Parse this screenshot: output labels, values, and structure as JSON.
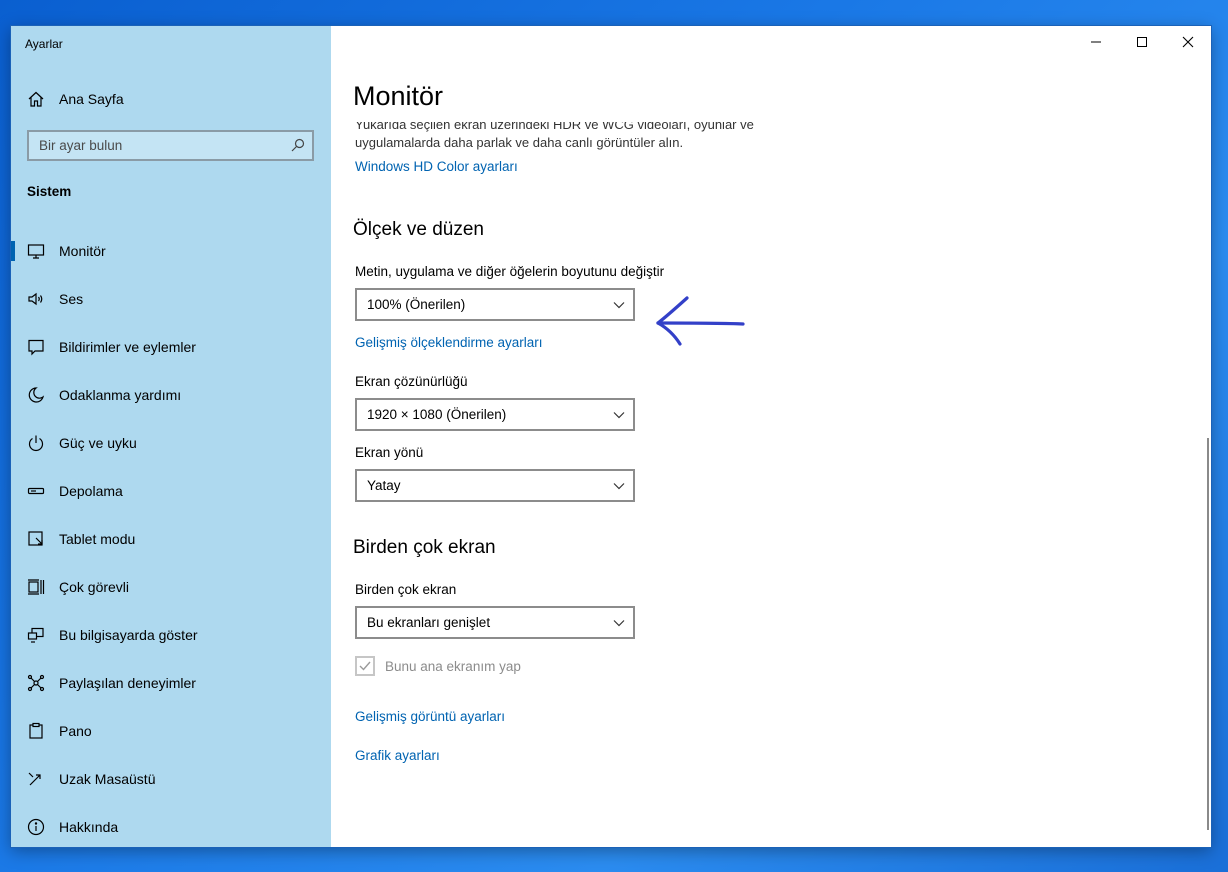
{
  "window": {
    "app_title": "Ayarlar",
    "controls": [
      "minimize",
      "maximize",
      "close"
    ]
  },
  "sidebar": {
    "home_label": "Ana Sayfa",
    "search_placeholder": "Bir ayar bulun",
    "section": "Sistem",
    "items": [
      {
        "label": "Monitör",
        "icon": "monitor-icon",
        "active": true
      },
      {
        "label": "Ses",
        "icon": "speaker-icon"
      },
      {
        "label": "Bildirimler ve eylemler",
        "icon": "notification-icon"
      },
      {
        "label": "Odaklanma yardımı",
        "icon": "moon-icon"
      },
      {
        "label": "Güç ve uyku",
        "icon": "power-icon"
      },
      {
        "label": "Depolama",
        "icon": "storage-icon"
      },
      {
        "label": "Tablet modu",
        "icon": "tablet-icon"
      },
      {
        "label": "Çok görevli",
        "icon": "multitask-icon"
      },
      {
        "label": "Bu bilgisayarda göster",
        "icon": "project-icon"
      },
      {
        "label": "Paylaşılan deneyimler",
        "icon": "shared-icon"
      },
      {
        "label": "Pano",
        "icon": "clipboard-icon"
      },
      {
        "label": "Uzak Masaüstü",
        "icon": "remote-icon"
      },
      {
        "label": "Hakkında",
        "icon": "info-icon"
      }
    ]
  },
  "main": {
    "title": "Monitör",
    "hdr_text_line1": "Yukarıda seçilen ekran üzerindeki HDR ve WCG videoları, oyunlar ve",
    "hdr_text_line2": "uygulamalarda daha parlak ve daha canlı görüntüler alın.",
    "hdr_link": "Windows HD Color ayarları",
    "scale_section": "Ölçek ve düzen",
    "scale_label": "Metin, uygulama ve diğer öğelerin boyutunu değiştir",
    "scale_value": "100% (Önerilen)",
    "advanced_scale_link": "Gelişmiş ölçeklendirme ayarları",
    "resolution_label": "Ekran çözünürlüğü",
    "resolution_value": "1920 × 1080 (Önerilen)",
    "orientation_label": "Ekran yönü",
    "orientation_value": "Yatay",
    "multi_section": "Birden çok ekran",
    "multi_label": "Birden çok ekran",
    "multi_value": "Bu ekranları genişlet",
    "primary_checkbox_label": "Bunu ana ekranım yap",
    "primary_checked": true,
    "advanced_display_link": "Gelişmiş görüntü ayarları",
    "graphics_link": "Grafik ayarları"
  },
  "colors": {
    "sidebar_bg": "#aed9ef",
    "accent": "#0063b1",
    "annotation": "#3340c8"
  }
}
